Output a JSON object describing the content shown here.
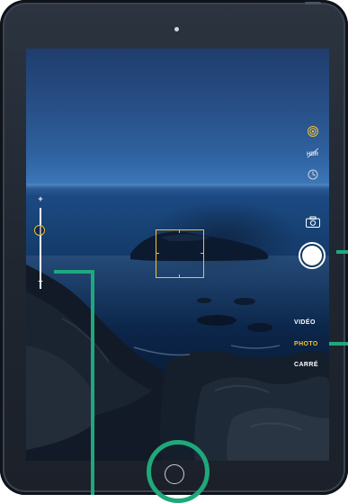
{
  "camera": {
    "exposure": {
      "plus_label": "+",
      "minus_label": "–",
      "level": 0.72
    },
    "right_controls": {
      "icons": [
        "live-photo-icon",
        "hdr-off-icon",
        "timer-icon",
        "switch-camera-icon"
      ]
    },
    "modes": [
      {
        "label": "VIDÉO",
        "active": false
      },
      {
        "label": "PHOTO",
        "active": true
      },
      {
        "label": "CARRÉ",
        "active": false
      }
    ]
  },
  "colors": {
    "accent": "#f2c230",
    "callout": "#1fa87c",
    "bezel": "#252c36"
  }
}
